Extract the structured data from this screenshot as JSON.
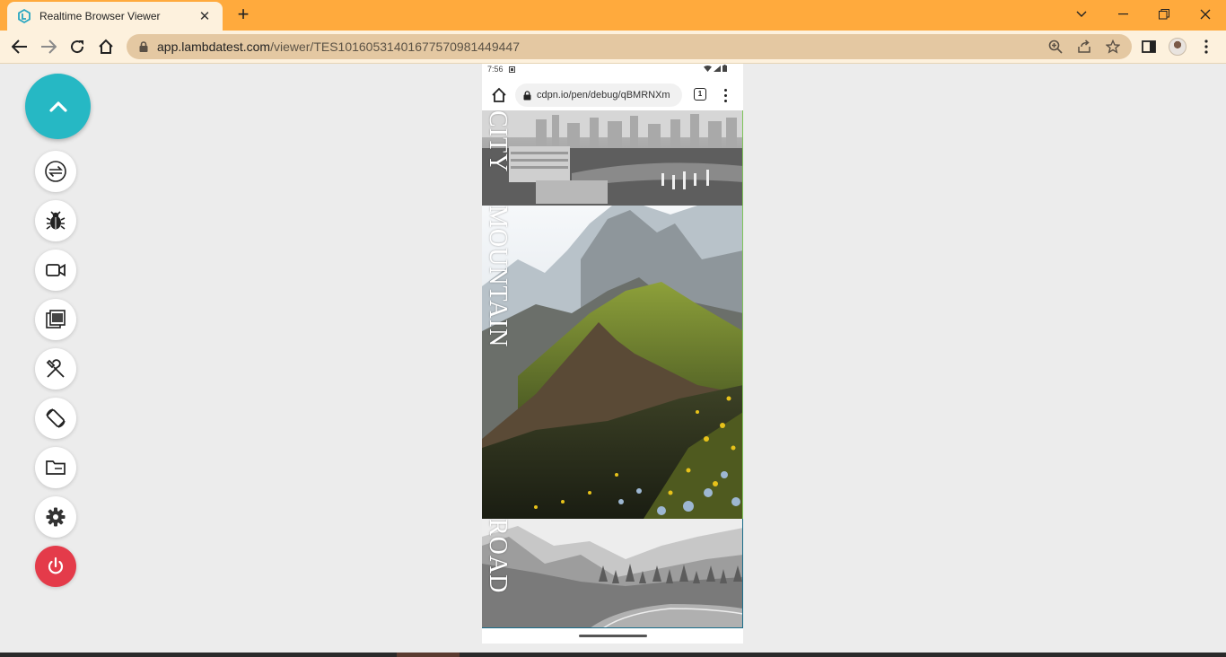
{
  "browser": {
    "tab_title": "Realtime Browser Viewer",
    "tab_close": "✕",
    "new_tab": "+",
    "url_host": "app.lambdatest.com",
    "url_path": "/viewer/TES101605314016775709814494​47"
  },
  "side_toolbar": {
    "items": [
      {
        "icon": "switch-icon"
      },
      {
        "icon": "bug-icon"
      },
      {
        "icon": "video-icon"
      },
      {
        "icon": "gallery-icon"
      },
      {
        "icon": "tools-icon"
      },
      {
        "icon": "rotate-icon"
      },
      {
        "icon": "folder-icon"
      },
      {
        "icon": "gear-icon"
      },
      {
        "icon": "power-icon"
      }
    ],
    "accent_color": "#26b8c4",
    "power_color": "#e43b4a"
  },
  "device": {
    "status_time": "7:56",
    "url": "cdpn.io/pen/debug/qBMRNXm",
    "tab_count": "1",
    "panels": [
      {
        "label": "CITY"
      },
      {
        "label": "MOUNTAIN"
      },
      {
        "label": "ROAD"
      }
    ]
  },
  "colors": {
    "tab_strip": "#ffaa3d",
    "toolbar": "#fdf1dd",
    "omnibox": "#e4c8a2",
    "page_bg": "#ececec"
  }
}
